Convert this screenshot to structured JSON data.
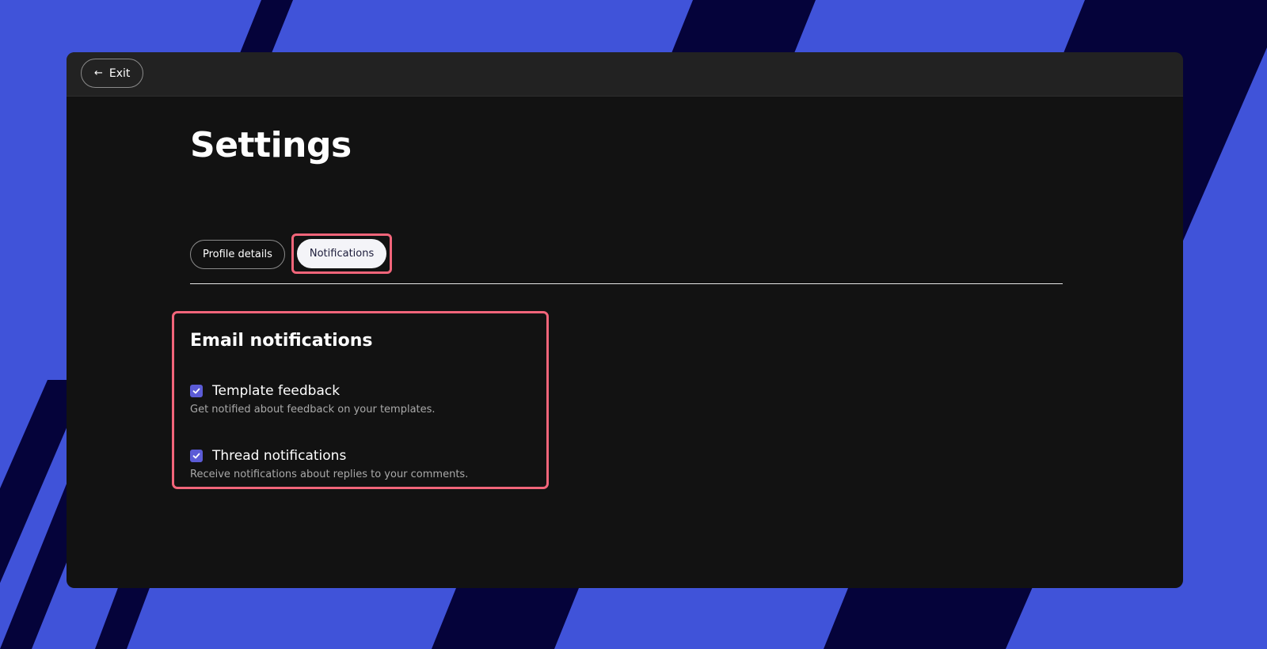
{
  "header": {
    "exit_label": "Exit",
    "exit_icon": "arrow-left-icon"
  },
  "page": {
    "title": "Settings"
  },
  "tabs": [
    {
      "label": "Profile details",
      "active": false
    },
    {
      "label": "Notifications",
      "active": true
    }
  ],
  "email_notifications": {
    "title": "Email notifications",
    "options": [
      {
        "label": "Template feedback",
        "description": "Get notified about feedback on your templates.",
        "checked": true
      },
      {
        "label": "Thread notifications",
        "description": "Receive notifications about replies to your comments.",
        "checked": true
      }
    ]
  },
  "colors": {
    "background_blue": "#4053d9",
    "background_navy": "#05033a",
    "window": "#121212",
    "topbar": "#222222",
    "accent_checkbox": "#5b5bd6",
    "highlight": "#f2657a"
  }
}
